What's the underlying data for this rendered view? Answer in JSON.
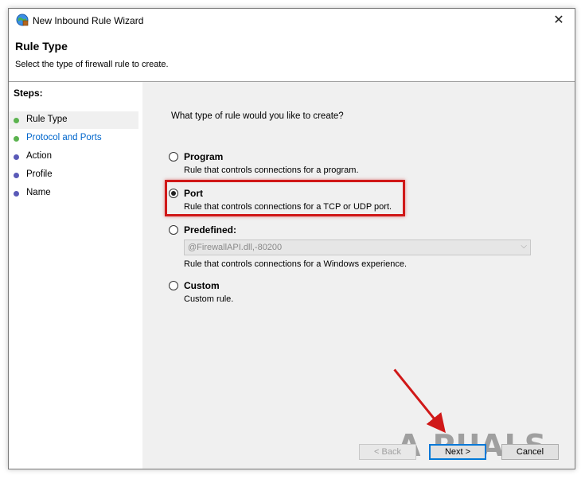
{
  "window": {
    "title": "New Inbound Rule Wizard",
    "close_glyph": "✕"
  },
  "header": {
    "title": "Rule Type",
    "subtitle": "Select the type of firewall rule to create."
  },
  "steps": {
    "label": "Steps:",
    "items": [
      {
        "label": "Rule Type",
        "state": "done",
        "dot_color": "#5bb34f"
      },
      {
        "label": "Protocol and Ports",
        "state": "link",
        "dot_color": "#5bb34f"
      },
      {
        "label": "Action",
        "state": "pending",
        "dot_color": "#5a5ab8"
      },
      {
        "label": "Profile",
        "state": "pending",
        "dot_color": "#5a5ab8"
      },
      {
        "label": "Name",
        "state": "pending",
        "dot_color": "#5a5ab8"
      }
    ]
  },
  "main": {
    "question": "What type of rule would you like to create?",
    "options": [
      {
        "label": "Program",
        "desc": "Rule that controls connections for a program.",
        "checked": false
      },
      {
        "label": "Port",
        "desc": "Rule that controls connections for a TCP or UDP port.",
        "checked": true
      },
      {
        "label": "Predefined:",
        "desc": "Rule that controls connections for a Windows experience.",
        "checked": false
      },
      {
        "label": "Custom",
        "desc": "Custom rule.",
        "checked": false
      }
    ],
    "predefined_value": "@FirewallAPI.dll,-80200"
  },
  "buttons": {
    "back": "< Back",
    "next": "Next >",
    "cancel": "Cancel"
  },
  "watermark": "A  PUALS",
  "colors": {
    "highlight": "#d01818",
    "link": "#0066cc",
    "focus": "#0078d7"
  }
}
